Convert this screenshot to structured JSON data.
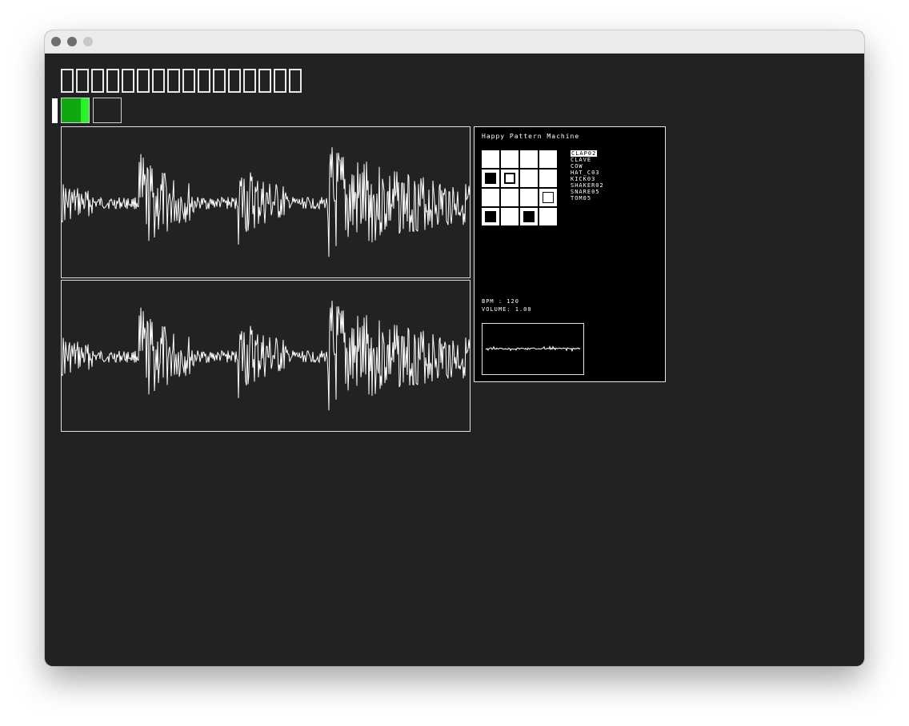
{
  "window": {
    "title": ""
  },
  "toolbar": {
    "placeholder_glyph_count": 16,
    "play_button_progress": 0.3
  },
  "waveforms": [
    {
      "name": "channel-left"
    },
    {
      "name": "channel-right"
    }
  ],
  "machine": {
    "title": "Happy Pattern Machine",
    "grid": [
      [
        "empty",
        "empty",
        "empty",
        "empty"
      ],
      [
        "filled",
        "outline-thick",
        "empty",
        "empty"
      ],
      [
        "empty",
        "empty",
        "empty",
        "outline"
      ],
      [
        "filled",
        "empty",
        "filled",
        "empty"
      ]
    ],
    "samples": [
      "CLAP02",
      "CLAVE",
      "COW",
      "HAT_C03",
      "KICK03",
      "SHAKER02",
      "SNARE05",
      "TOM05"
    ],
    "selected_sample_index": 0,
    "bpm_label": "BPM   : 120",
    "volume_label": "VOLUME: 1.00"
  },
  "colors": {
    "background": "#222222",
    "accent_green": "#11a711",
    "accent_green_bright": "#29f229",
    "panel": "#000000",
    "line": "#ffffff"
  }
}
